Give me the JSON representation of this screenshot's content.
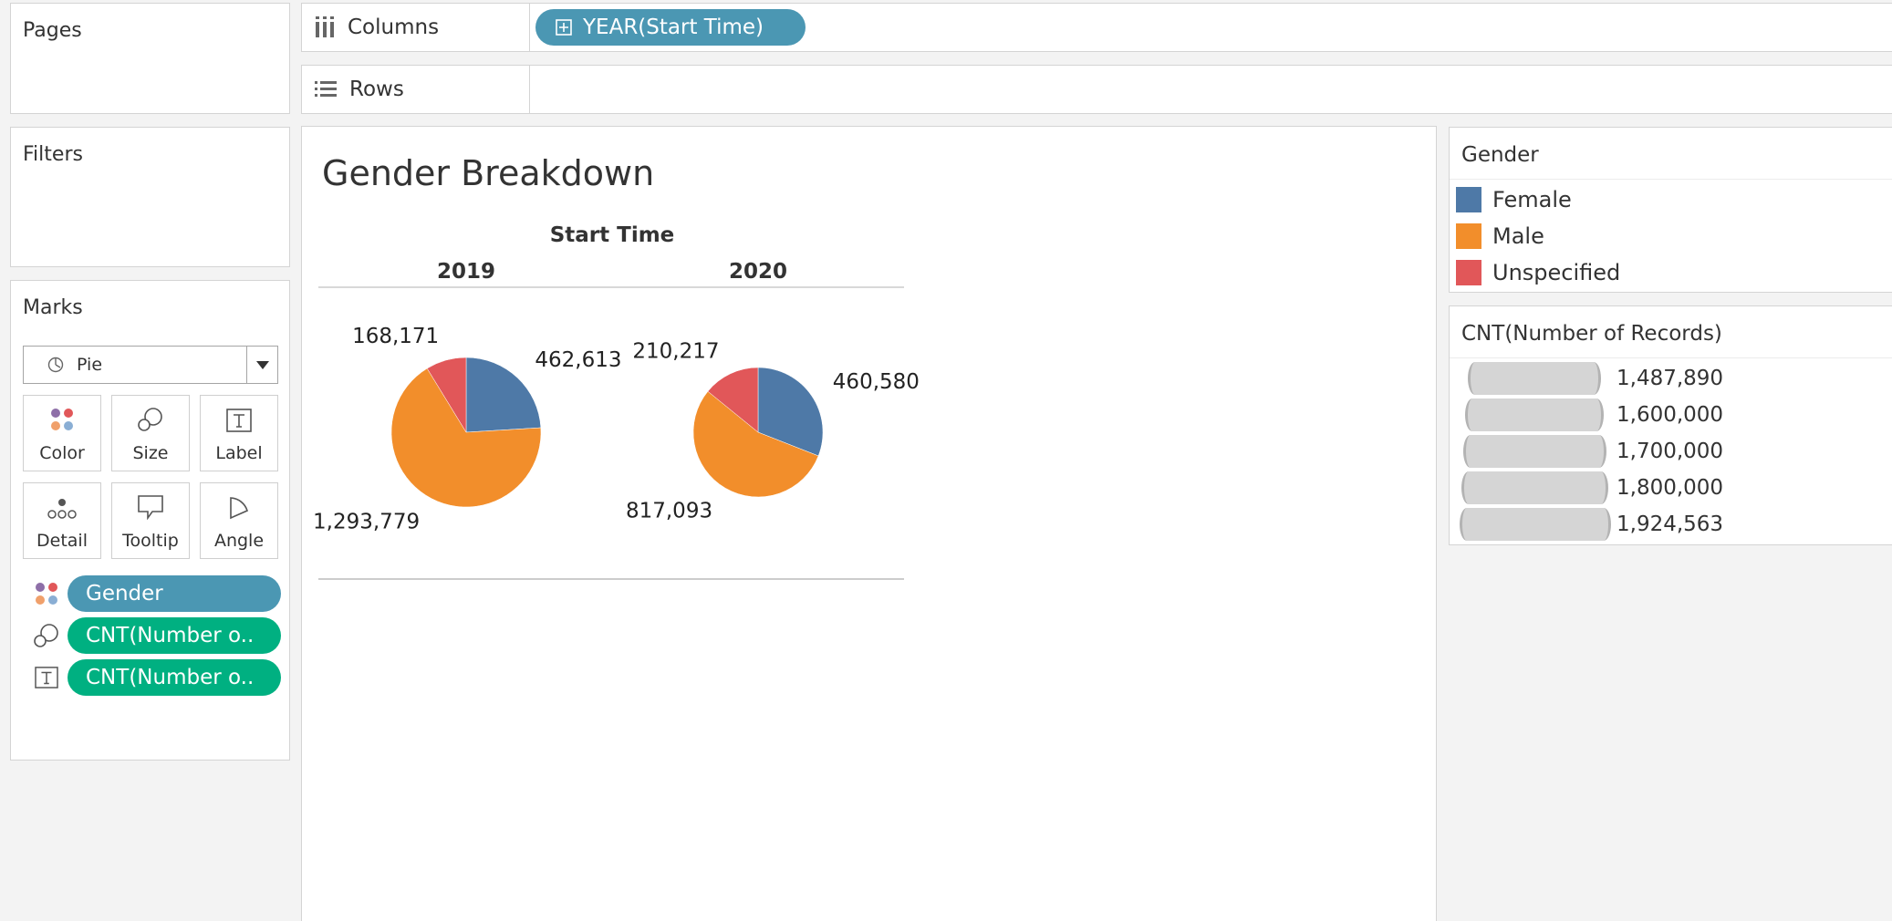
{
  "cards": {
    "pages": "Pages",
    "filters": "Filters",
    "marks": "Marks"
  },
  "shelves": {
    "columns_label": "Columns",
    "columns_pill": "YEAR(Start Time)",
    "rows_label": "Rows"
  },
  "marks": {
    "type": "Pie",
    "buttons": [
      "Color",
      "Size",
      "Label",
      "Detail",
      "Tooltip",
      "Angle"
    ],
    "fields": [
      "Gender",
      "CNT(Number o..",
      "CNT(Number o.."
    ]
  },
  "view": {
    "title": "Gender Breakdown",
    "column_header": "Start Time"
  },
  "legend_color": {
    "title": "Gender",
    "items": [
      {
        "name": "Female",
        "color": "#4e79a7"
      },
      {
        "name": "Male",
        "color": "#f28e2b"
      },
      {
        "name": "Unspecified",
        "color": "#e15759"
      }
    ]
  },
  "legend_size": {
    "title": "CNT(Number of Records)",
    "items": [
      "1,487,890",
      "1,600,000",
      "1,700,000",
      "1,800,000",
      "1,924,563"
    ]
  },
  "chart_data": {
    "type": "pie",
    "title": "Gender Breakdown",
    "facet_label": "Start Time",
    "categories": [
      "Female",
      "Male",
      "Unspecified"
    ],
    "colors": [
      "#4e79a7",
      "#f28e2b",
      "#e15759"
    ],
    "pies": [
      {
        "label": "2019",
        "values": [
          462613,
          1293779,
          168171
        ],
        "value_labels": [
          "462,613",
          "1,293,779",
          "168,171"
        ]
      },
      {
        "label": "2020",
        "values": [
          460580,
          817093,
          210217
        ],
        "value_labels": [
          "460,580",
          "817,093",
          "210,217"
        ]
      }
    ],
    "size_range": [
      1487890,
      1924563
    ]
  }
}
